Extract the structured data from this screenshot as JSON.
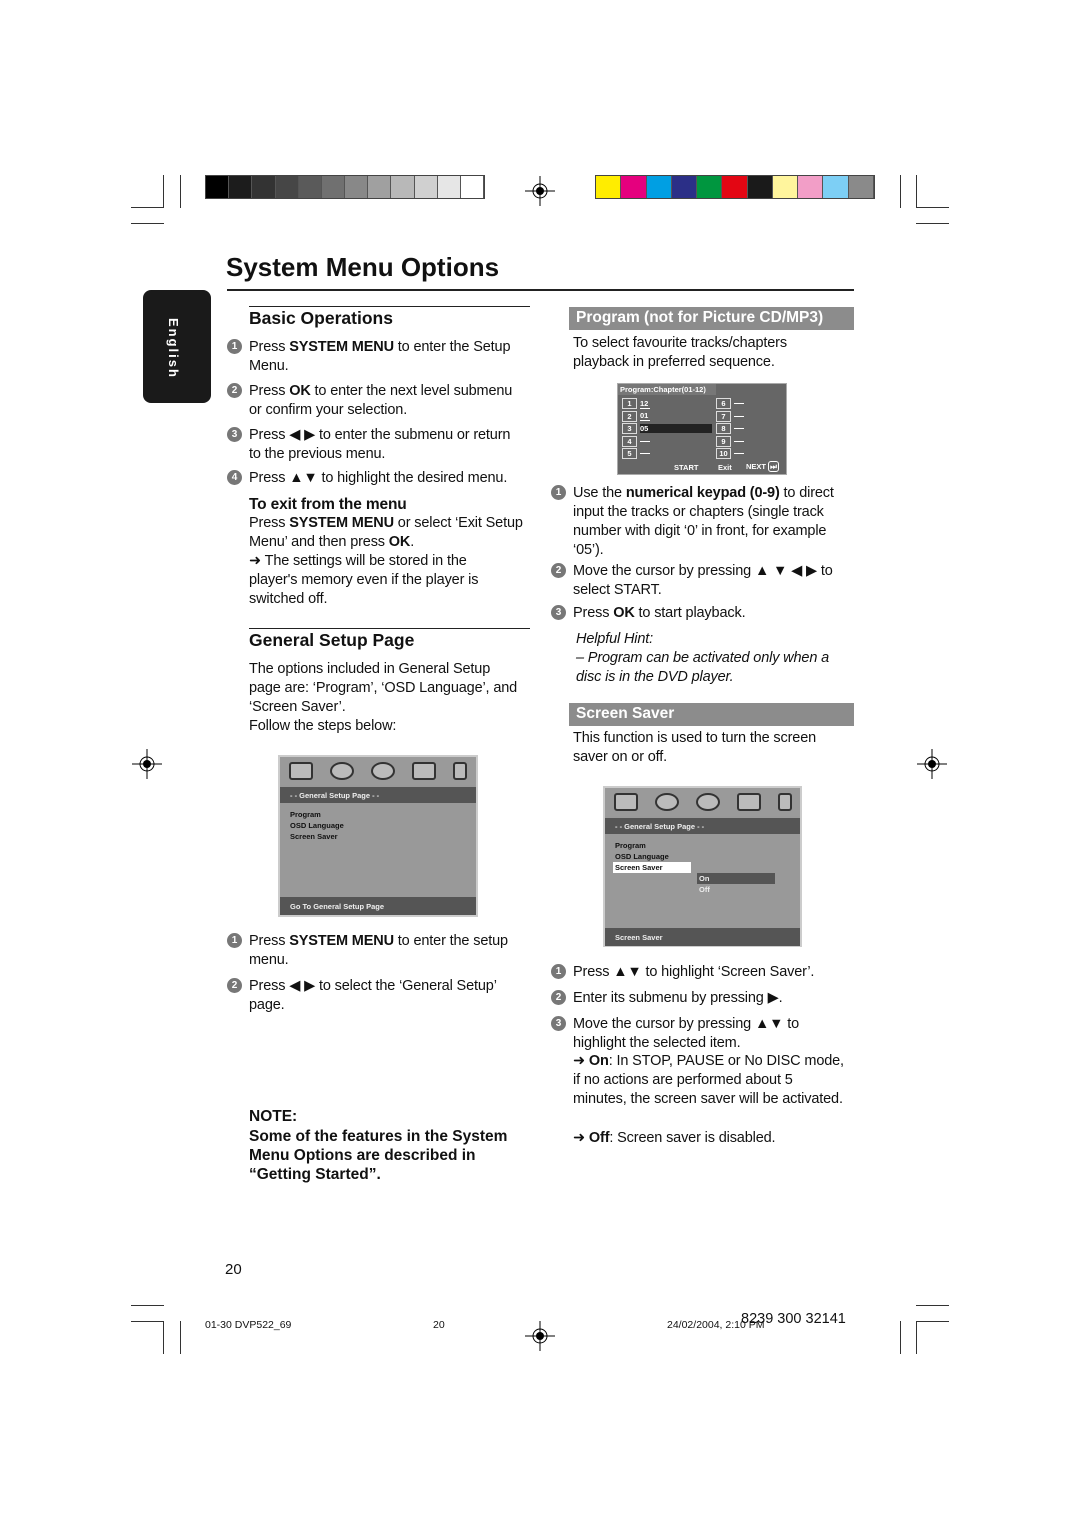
{
  "title": "System Menu Options",
  "language_tab": "English",
  "color_bars": {
    "grayscale": [
      "#000000",
      "#1c1c1c",
      "#333333",
      "#464646",
      "#5a5a5a",
      "#707070",
      "#888888",
      "#a0a0a0",
      "#b8b8b8",
      "#d0d0d0",
      "#e6e6e6",
      "#ffffff"
    ],
    "colors": [
      "#ffed00",
      "#e5007e",
      "#009fe3",
      "#2b2f87",
      "#00963f",
      "#e30613",
      "#1a1a1a",
      "#fff59d",
      "#f29ec7",
      "#7dcff5",
      "#8a8a8a"
    ]
  },
  "basic": {
    "heading": "Basic Operations",
    "steps": [
      [
        [
          "Press ",
          0
        ],
        [
          "SYSTEM MENU",
          1
        ],
        [
          " to enter the Setup Menu.",
          0
        ]
      ],
      [
        [
          "Press ",
          0
        ],
        [
          "OK",
          1
        ],
        [
          " to enter the next level submenu or confirm your selection.",
          0
        ]
      ],
      [
        [
          "Press ◀ ▶  to enter the submenu or return to the previous menu.",
          0
        ]
      ],
      [
        [
          "Press ▲▼ to highlight the desired menu.",
          0
        ]
      ]
    ],
    "exit_heading": "To exit from the menu",
    "exit_text": [
      [
        "Press ",
        0
      ],
      [
        "SYSTEM MENU",
        1
      ],
      [
        " or select ‘Exit Setup Menu’ and then press ",
        0
      ],
      [
        "OK",
        1
      ],
      [
        ".",
        0
      ]
    ],
    "exit_note": "➜ The settings will be stored in the player's memory even if the player is switched off."
  },
  "general": {
    "heading": "General Setup Page",
    "text": "The options included in General Setup page are: ‘Program’, ‘OSD Language’, and ‘Screen Saver’.",
    "follow": "Follow the steps below:",
    "screen": {
      "header": "- - General Setup Page - -",
      "items": [
        "Program",
        "OSD Language",
        "Screen Saver"
      ],
      "footer": "Go To General Setup Page"
    },
    "steps": [
      [
        [
          "Press ",
          0
        ],
        [
          "SYSTEM MENU",
          1
        ],
        [
          " to enter the setup menu.",
          0
        ]
      ],
      [
        [
          "Press ◀ ▶ to select the ‘General Setup’ page.",
          0
        ]
      ]
    ],
    "note_heading": "NOTE:",
    "note_text": "Some of the features in the System Menu Options are described in “Getting Started”."
  },
  "program": {
    "heading": "Program (not for Picture CD/MP3)",
    "text": "To select favourite tracks/chapters playback in preferred sequence.",
    "screen": {
      "title": "Program:Chapter(01-12)",
      "slots": [
        {
          "n": "1",
          "v": "12"
        },
        {
          "n": "2",
          "v": "01"
        },
        {
          "n": "3",
          "v": "05"
        },
        {
          "n": "4",
          "v": ""
        },
        {
          "n": "5",
          "v": ""
        },
        {
          "n": "6",
          "v": ""
        },
        {
          "n": "7",
          "v": ""
        },
        {
          "n": "8",
          "v": ""
        },
        {
          "n": "9",
          "v": ""
        },
        {
          "n": "10",
          "v": ""
        }
      ],
      "start": "START",
      "exit": "Exit",
      "next": "NEXT"
    },
    "steps": [
      [
        [
          "Use the ",
          0
        ],
        [
          "numerical keypad (0-9)",
          1
        ],
        [
          " to direct input the tracks or chapters (single track number with digit ‘0’ in front, for example ‘05’).",
          0
        ]
      ],
      [
        [
          "Move the cursor by pressing ▲ ▼ ◀ ▶ to select START.",
          0
        ]
      ],
      [
        [
          "Press ",
          0
        ],
        [
          "OK",
          1
        ],
        [
          " to start playback.",
          0
        ]
      ]
    ],
    "hint_title": "Helpful Hint:",
    "hint_text": "–    Program can be activated only when a disc is in the DVD player."
  },
  "saver": {
    "heading": "Screen Saver",
    "text": "This function is used to turn the screen saver on or off.",
    "screen": {
      "header": "- - General Setup Page - -",
      "items": [
        "Program",
        "OSD Language",
        "Screen Saver"
      ],
      "options": [
        "On",
        "Off"
      ],
      "footer": "Screen Saver"
    },
    "steps": [
      [
        [
          "Press ▲▼ to highlight ‘Screen Saver’.",
          0
        ]
      ],
      [
        [
          "Enter its submenu by pressing ▶.",
          0
        ]
      ],
      [
        [
          "Move the cursor by pressing ▲▼ to highlight the selected item.",
          0
        ]
      ]
    ],
    "on_text": [
      [
        "➜ ",
        0
      ],
      [
        "On",
        1
      ],
      [
        ": In STOP, PAUSE or No DISC mode, if no actions are performed about 5 minutes, the screen saver will be activated.",
        0
      ]
    ],
    "off_text": [
      [
        "➜ ",
        0
      ],
      [
        "Off",
        1
      ],
      [
        ": Screen saver is disabled.",
        0
      ]
    ]
  },
  "page_number": "20",
  "footer": {
    "file": "01-30 DVP522_69",
    "page": "20",
    "date": "24/02/2004, 2:10 PM",
    "code": "8239 300 32141"
  }
}
